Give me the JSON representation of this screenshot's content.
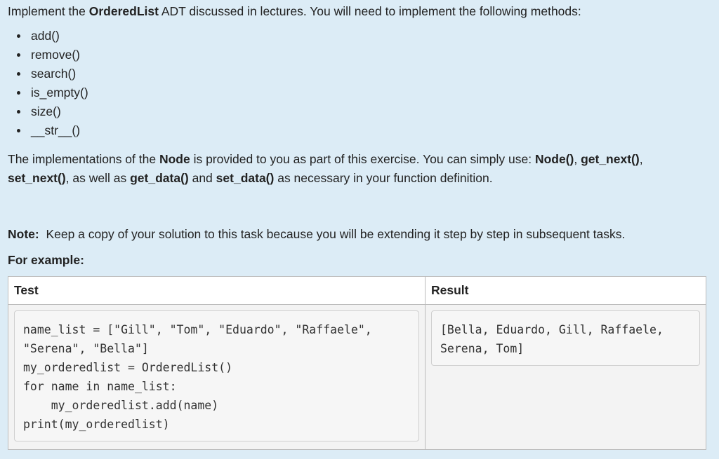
{
  "intro": {
    "prefix": "Implement the ",
    "adt_name": "OrderedList",
    "suffix": " ADT discussed in lectures. You will need to implement the following methods:"
  },
  "methods": [
    "add()",
    "remove()",
    "search()",
    "is_empty()",
    "size()",
    "__str__()"
  ],
  "node_paragraph": {
    "t1": "The implementations of the ",
    "node": "Node",
    "t2": " is provided to you as part of this exercise. You can simply use: ",
    "node_ctor": "Node()",
    "sep1": ", ",
    "get_next": "get_next()",
    "sep2": ", ",
    "set_next": "set_next()",
    "t3": ", as well as ",
    "get_data": "get_data()",
    "t4": " and ",
    "set_data": "set_data()",
    "t5": " as necessary in your function definition."
  },
  "note": {
    "label": "Note:",
    "text": "  Keep a copy of your solution to this task because you will be extending it step by step in subsequent tasks."
  },
  "example_heading": "For example:",
  "table": {
    "headers": {
      "test": "Test",
      "result": "Result"
    },
    "test_code": "name_list = [\"Gill\", \"Tom\", \"Eduardo\", \"Raffaele\",\n\"Serena\", \"Bella\"]\nmy_orderedlist = OrderedList()\nfor name in name_list:\n    my_orderedlist.add(name)\nprint(my_orderedlist)",
    "result_text": "[Bella, Eduardo, Gill, Raffaele,\nSerena, Tom]"
  },
  "colors": {
    "page_background": "#dcecf6",
    "table_header_background": "#ffffff",
    "code_background": "#f6f6f6"
  }
}
